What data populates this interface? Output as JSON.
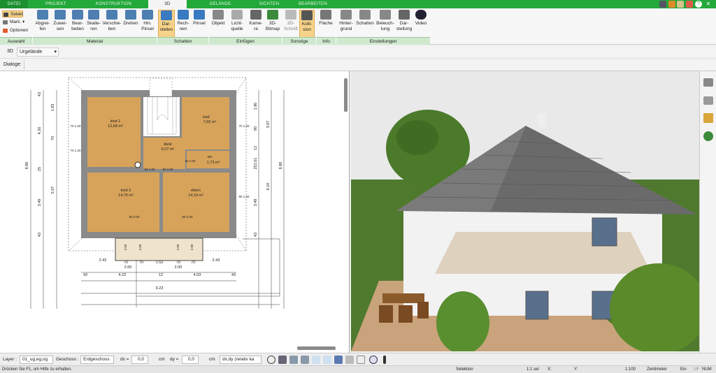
{
  "menu": {
    "tabs": [
      {
        "label": "DATEI",
        "active": false
      },
      {
        "label": "PROJEKT",
        "active": false
      },
      {
        "label": "KONSTRUKTION",
        "active": false
      },
      {
        "label": "3D",
        "active": true
      },
      {
        "label": "GELÄNDE",
        "active": false
      },
      {
        "label": "SICHTEN",
        "active": false
      },
      {
        "label": "BEARBEITEN",
        "active": false
      }
    ]
  },
  "ribbon": {
    "auswahl": {
      "selekt": "Selekt",
      "mark": "Mark.",
      "optionen": "Optionen"
    },
    "material_buttons": [
      "Abgrei-\nfen",
      "Zuwei-\nsen",
      "Bear-\nbeiten",
      "Skalie-\nren",
      "Verschie-\nben",
      "Drehen",
      "Hin.\nPinsel"
    ],
    "schatten_buttons": [
      "Dar-\nstellen",
      "Rech-\nnen",
      "Pinsel"
    ],
    "einfuegen_buttons": [
      "Objekt",
      "Licht-\nquelle",
      "Kame-\nra",
      "3D-\nBitmap"
    ],
    "sonstige_buttons": [
      "3D-\nSchnitt",
      "Kolli-\nsion"
    ],
    "info_buttons": [
      "Fläche"
    ],
    "einstellungen_buttons": [
      "Hinter-\ngrund",
      "Schatten",
      "Beleuch-\ntung",
      "Dar-\nstellung",
      "Video"
    ],
    "groups": [
      "Auswahl",
      "Material",
      "Schatten",
      "Einfügen",
      "Sonstige",
      "Info",
      "Einstellungen"
    ]
  },
  "viewbar": {
    "mode": "3D",
    "terrain": "Urgelände"
  },
  "dialoge_label": "Dialoge:",
  "plan": {
    "rooms": [
      {
        "name": "kind 1",
        "area": "12,68 m²"
      },
      {
        "name": "bad",
        "area": "7,65 m²"
      },
      {
        "name": "diele",
        "area": "6,07 m²"
      },
      {
        "name": "wc",
        "area": "1,73 m²"
      },
      {
        "name": "kind 2",
        "area": "14,76 m²"
      },
      {
        "name": "eltern",
        "area": "14,10 m²"
      }
    ],
    "door_labels": [
      "80\n2.00",
      "80\n2.00",
      "80\n2.00",
      "80\n2.00",
      "80\n2.00"
    ],
    "window_labels_left": [
      "70\n1.20",
      "70\n1.20"
    ],
    "window_labels_right": [
      "70\n1.20",
      "90\n1.20"
    ],
    "dims_left_outer": [
      "8.80"
    ],
    "dims_left_mid": [
      "43",
      "4.20",
      "25",
      "3.49",
      "43"
    ],
    "dims_left_inner": [
      "1.83",
      "70",
      "5.57"
    ],
    "dims_right_inner": [
      "1.80",
      "90",
      "12",
      "251.01",
      "3.49",
      "43"
    ],
    "dims_right_mid": [
      "3.07",
      "6.10"
    ],
    "dims_right_outer": [
      "8.80"
    ],
    "balcony_labels": [
      "2.00",
      "2.00",
      "2.00",
      "2.00"
    ],
    "dims_bottom_row1": [
      "2.42",
      "70",
      "70",
      "1.52",
      "70",
      "70",
      "2.43"
    ],
    "dims_bottom_row2": [
      "2.00",
      "2.00"
    ],
    "dims_bottom_row3": [
      "43",
      "4.22",
      "12",
      "4.03",
      "43"
    ],
    "dims_bottom_total": "9.23"
  },
  "bottombar": {
    "layer_label": "Layer :",
    "layer_value": "01_ug,eg,og",
    "geschoss_label": "Geschoss :",
    "geschoss_value": "Erdgeschoss",
    "dx_label": "dx =",
    "dx_value": "0,0",
    "dy_label": "dy =",
    "dy_value": "0,0",
    "unit": "cm",
    "coord_mode": "dx,dy (relativ ka"
  },
  "status": {
    "hint": "Drücken Sie F1, um Hilfe zu erhalten.",
    "mode": "Selektion",
    "scale": "1:1 sel",
    "x": "X:",
    "y": "Y:",
    "zoom": "1:100",
    "unit": "Zentimeter",
    "ein": "Ein",
    "uf": "UF",
    "num": "NUM"
  },
  "colors": {
    "accent": "#23a83a",
    "room_floor": "#d7a35a",
    "ribbon_group": "#cfe9cf"
  }
}
